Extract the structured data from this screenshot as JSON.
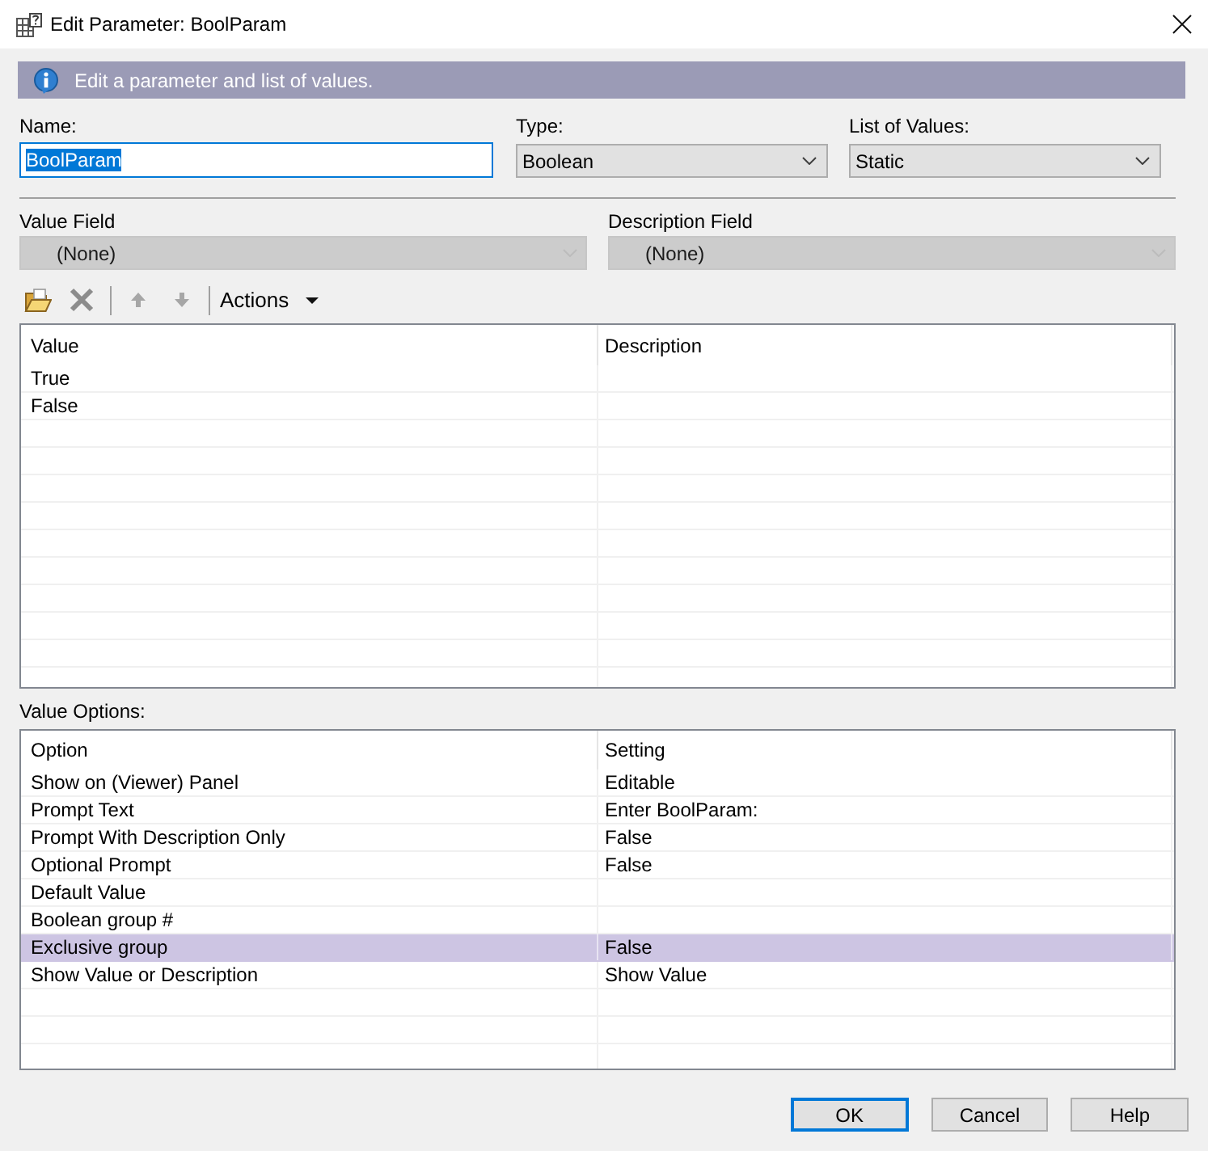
{
  "window": {
    "title": "Edit Parameter: BoolParam"
  },
  "banner": {
    "text": "Edit a parameter and list of values."
  },
  "name": {
    "label": "Name:",
    "value": "BoolParam",
    "text_selected": true
  },
  "type": {
    "label": "Type:",
    "value": "Boolean",
    "disabled": false
  },
  "list_of_values": {
    "label": "List of Values:",
    "value": "Static",
    "disabled": false
  },
  "value_field": {
    "label": "Value Field",
    "value": "(None)",
    "disabled": true
  },
  "description_field": {
    "label": "Description Field",
    "value": "(None)",
    "disabled": true
  },
  "toolbar": {
    "actions": "Actions"
  },
  "values_table": {
    "columns": [
      "Value",
      "Description"
    ],
    "rows": [
      {
        "value": "True"
      },
      {
        "value": "False"
      }
    ]
  },
  "value_options": {
    "label": "Value Options:",
    "columns": [
      "Option",
      "Setting"
    ],
    "rows": [
      {
        "option": "Show on (Viewer) Panel",
        "setting": "Editable",
        "selected": false
      },
      {
        "option": "Prompt Text",
        "setting": "Enter BoolParam:",
        "selected": false
      },
      {
        "option": "Prompt With Description Only",
        "setting": "False",
        "selected": false
      },
      {
        "option": "Optional Prompt",
        "setting": "False",
        "selected": false
      },
      {
        "option": "Default Value",
        "selected": false
      },
      {
        "option": "Boolean group #",
        "selected": false
      },
      {
        "option": "Exclusive group",
        "setting": "False",
        "selected": true
      },
      {
        "option": "Show Value or Description",
        "setting": "Show Value",
        "selected": false
      }
    ]
  },
  "buttons": [
    {
      "label": "OK",
      "default": true
    },
    {
      "label": "Cancel",
      "default": false
    },
    {
      "label": "Help",
      "default": false
    }
  ]
}
